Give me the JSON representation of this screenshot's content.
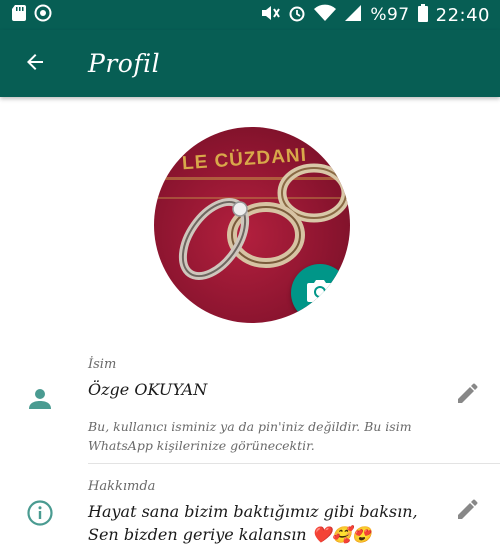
{
  "status_bar": {
    "battery_text": "%97",
    "time": "22:40"
  },
  "app_bar": {
    "title": "Profil",
    "back_icon": "arrow-left-icon"
  },
  "profile_photo": {
    "visible_text": "LE CÜZDANI",
    "camera_icon": "camera-icon"
  },
  "name_section": {
    "label": "İsim",
    "value": "Özge OKUYAN",
    "hint": "Bu, kullanıcı isminiz ya da pin'iniz değildir. Bu isim WhatsApp kişilerinize görünecektir.",
    "icon": "person-icon",
    "edit_icon": "pencil-icon"
  },
  "about_section": {
    "label": "Hakkımda",
    "value": "Hayat sana bizim baktığımız gibi baksın, Sen bizden geriye kalansın ❤️🥰😍",
    "icon": "info-icon",
    "edit_icon": "pencil-icon"
  },
  "colors": {
    "primary_dark": "#075e54",
    "accent": "#009688"
  }
}
